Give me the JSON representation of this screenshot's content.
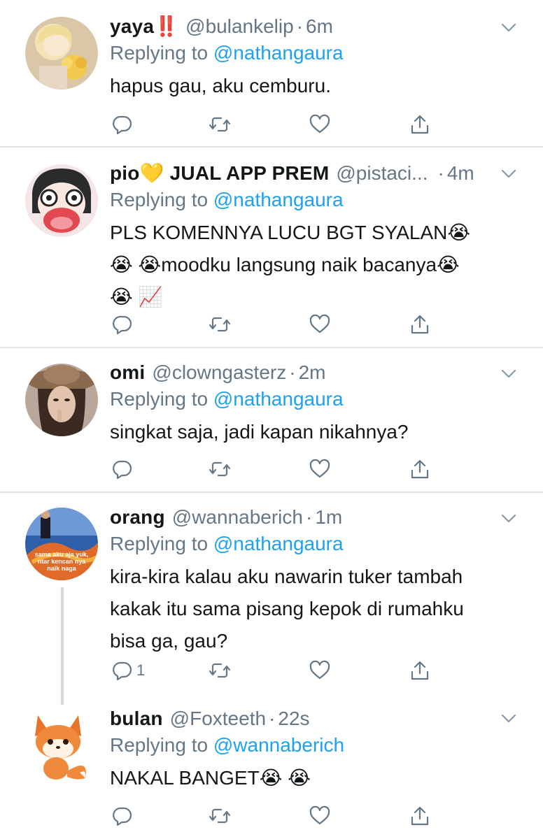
{
  "reply_prefix": "Replying to",
  "tweets": [
    {
      "name": "yaya",
      "name_emoji": "‼️",
      "handle": "@bulankelip",
      "time": "6m",
      "reply_to": "@nathangaura",
      "text": "hapus gau, aku cemburu.",
      "reply_count": ""
    },
    {
      "name": "pio",
      "name_emoji": "💛",
      "name_suffix": "JUAL APP PREM",
      "handle": "@pistaci...",
      "time": "4m",
      "reply_to": "@nathangaura",
      "text_line1": "PLS KOMENNYA LUCU BGT SYALAN😭",
      "text_line2": "😭 😭moodku langsung naik bacanya😭",
      "text_line3": "😭 📈",
      "reply_count": ""
    },
    {
      "name": "omi",
      "handle": "@clowngasterz",
      "time": "2m",
      "reply_to": "@nathangaura",
      "text": "singkat saja, jadi kapan nikahnya?",
      "reply_count": ""
    },
    {
      "name": "orang",
      "handle": "@wannaberich",
      "time": "1m",
      "reply_to": "@nathangaura",
      "text_line1": "kira-kira kalau aku nawarin tuker tambah",
      "text_line2": "kakak itu sama pisang kepok di rumahku",
      "text_line3": "bisa ga, gau?",
      "reply_count": "1",
      "avatar_caption_1": "sama aku aja yuk,",
      "avatar_caption_2": "ntar kencan nya",
      "avatar_caption_3": "naik naga"
    },
    {
      "name": "bulan",
      "handle": "@Foxteeth",
      "time": "22s",
      "reply_to": "@wannaberich",
      "text": "NAKAL BANGET😭 😭",
      "reply_count": ""
    }
  ],
  "icons": [
    "reply-icon",
    "retweet-icon",
    "like-icon",
    "share-icon",
    "chevron-down-icon"
  ],
  "colors": {
    "link": "#1da1f2",
    "muted": "#657786",
    "text": "#14171a",
    "divider": "#dfe4e8"
  }
}
